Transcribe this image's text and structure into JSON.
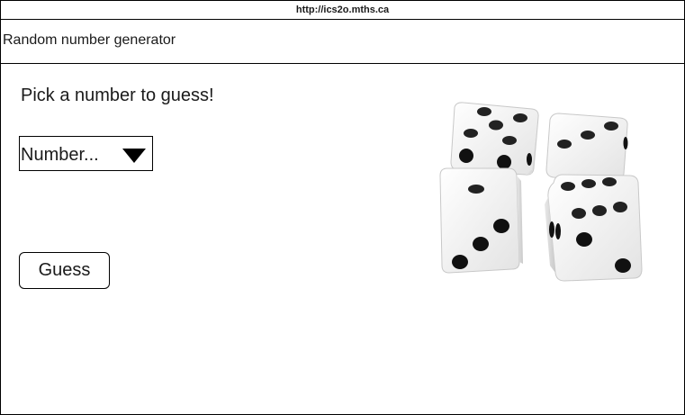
{
  "browser": {
    "url": "http://ics2o.mths.ca"
  },
  "page": {
    "title": "Random number generator",
    "prompt": "Pick a number to guess!"
  },
  "number_select": {
    "selected": "Number..."
  },
  "guess_button": {
    "label": "Guess"
  },
  "image": {
    "icon": "dice-image"
  },
  "colors": {
    "border": "#000000",
    "background": "#ffffff",
    "text": "#1a1a1a"
  }
}
